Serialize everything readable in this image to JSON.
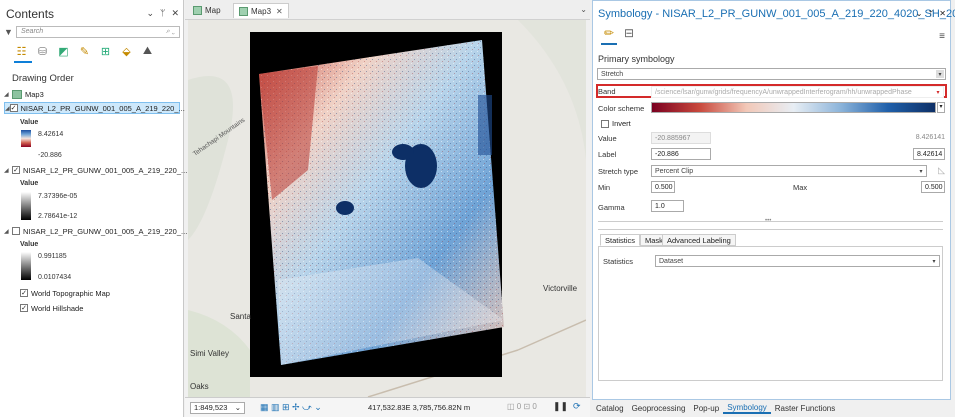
{
  "contents": {
    "title": "Contents",
    "search_placeholder": "Search",
    "drawing_order": "Drawing Order",
    "map_name": "Map3",
    "layers": [
      {
        "name": "NISAR_L2_PR_GUNW_001_005_A_219_220_...",
        "checked": true,
        "legend_title": "Value",
        "max": "8.42614",
        "min": "-20.886"
      },
      {
        "name": "NISAR_L2_PR_GUNW_001_005_A_219_220_...",
        "checked": true,
        "legend_title": "Value",
        "max": "7.37396e-05",
        "min": "2.78641e-12"
      },
      {
        "name": "NISAR_L2_PR_GUNW_001_005_A_219_220_...",
        "checked": false,
        "legend_title": "Value",
        "max": "0.991185",
        "min": "0.0107434"
      }
    ],
    "basemaps": [
      "World Topographic Map",
      "World Hillshade"
    ]
  },
  "map": {
    "tabs": [
      "Map",
      "Map3"
    ],
    "scale": "1:849,523",
    "coordinates": "417,532.83E 3,785,756.82N m",
    "place_labels": [
      "Victorville",
      "Santa",
      "Simi Valley",
      "Oaks",
      "Tehachapi Mountains"
    ]
  },
  "symbology": {
    "title": "Symbology - NISAR_L2_PR_GUNW_001_005_A_219_220_4020_SH_200...",
    "primary": "Primary symbology",
    "renderer": "Stretch",
    "band_label": "Band",
    "band_value": "/science/lsar/gunw/grids/frequencyA/unwrappedInterferogram/hh/unwrappedPhase",
    "color_scheme_label": "Color scheme",
    "invert_label": "Invert",
    "value_label": "Value",
    "value_min": "-20.885967",
    "value_max": "8.426141",
    "label_label": "Label",
    "label_min": "-20.886",
    "label_max": "8.42614",
    "stretch_type_label": "Stretch type",
    "stretch_type": "Percent Clip",
    "min_label": "Min",
    "min_value": "0.500",
    "max_label": "Max",
    "max_value": "0.500",
    "gamma_label": "Gamma",
    "gamma_value": "1.0",
    "stats_tabs": [
      "Statistics",
      "Mask",
      "Advanced Labeling"
    ],
    "statistics_label": "Statistics",
    "statistics_value": "Dataset"
  },
  "bottom_tabs": [
    "Catalog",
    "Geoprocessing",
    "Pop-up",
    "Symbology",
    "Raster Functions"
  ],
  "colors": {
    "accent": "#1a6fb3",
    "highlight": "#d42a2a",
    "selection": "#cde8fb"
  }
}
